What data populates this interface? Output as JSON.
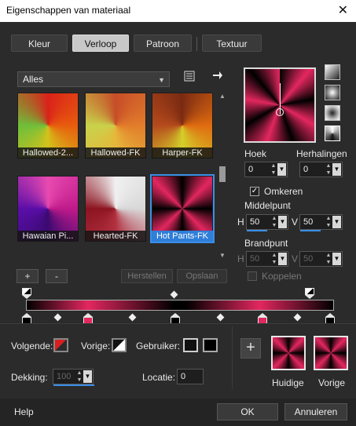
{
  "window": {
    "title": "Eigenschappen van materiaal",
    "close_glyph": "✕"
  },
  "tabs": [
    {
      "label": "Kleur",
      "active": false
    },
    {
      "label": "Verloop",
      "active": true
    },
    {
      "label": "Patroon",
      "active": false
    },
    {
      "label": "Textuur",
      "active": false
    }
  ],
  "preset_dropdown": {
    "value": "Alles"
  },
  "presets": [
    {
      "label": "Hallowed-2...",
      "colors": [
        "#6fbf3a",
        "#d4c21b",
        "#e85c0d",
        "#d9221a"
      ],
      "selected": false
    },
    {
      "label": "Hallowed-FK",
      "colors": [
        "#c9d24b",
        "#e6b73a",
        "#e27c2b",
        "#c64d28"
      ],
      "selected": false
    },
    {
      "label": "Harper-FK",
      "colors": [
        "#d4d12a",
        "#b54a1c",
        "#e06b10",
        "#7a2a12"
      ],
      "selected": false
    },
    {
      "label": "Hawaian Pi...",
      "colors": [
        "#5a0ea8",
        "#3a0a70",
        "#e84ab0",
        "#c01a8a"
      ],
      "selected": false
    },
    {
      "label": "Hearted-FK",
      "colors": [
        "#8c1420",
        "#d8d8d8",
        "#f0f0f0",
        "#b23040"
      ],
      "selected": false
    },
    {
      "label": "Hot Pants-FK",
      "colors": [
        "#000000",
        "#e3275f",
        "#000000",
        "#e3275f"
      ],
      "selected": true
    }
  ],
  "list_buttons": {
    "add": "+",
    "remove": "-",
    "restore": "Herstellen",
    "save": "Opslaan"
  },
  "angle": {
    "label": "Hoek",
    "value": "0"
  },
  "repeats": {
    "label": "Herhalingen",
    "value": "0"
  },
  "invert": {
    "label": "Omkeren",
    "checked": true
  },
  "center": {
    "label": "Middelpunt",
    "h_label": "H",
    "h_value": "50",
    "v_label": "V",
    "v_value": "50"
  },
  "focal": {
    "label": "Brandpunt",
    "h_label": "H",
    "h_value": "50",
    "v_label": "V",
    "v_value": "50"
  },
  "link": {
    "label": "Koppelen",
    "checked": false
  },
  "bottom": {
    "next_label": "Volgende:",
    "previous_label": "Vorige:",
    "user_label": "Gebruiker:",
    "opacity_label": "Dekking:",
    "opacity_value": "100",
    "location_label": "Locatie:",
    "location_value": "0",
    "add_glyph": "+",
    "current_label": "Huidige",
    "previous_preview_label": "Vorige"
  },
  "footer": {
    "help": "Help",
    "ok": "OK",
    "cancel": "Annuleren"
  },
  "colors": {
    "accent": "#3b8fe6",
    "gradient_pink": "#e3275f",
    "background": "#2b2b2b"
  },
  "icons": {
    "list_view": "list-icon",
    "export": "arrow-right-icon"
  }
}
